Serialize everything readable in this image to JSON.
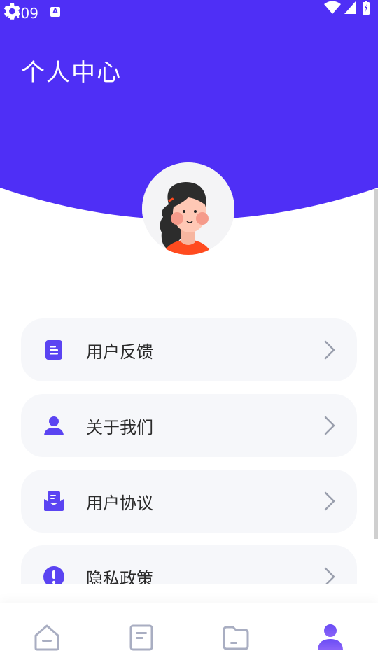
{
  "status_bar": {
    "time": "2:09",
    "notification_icon": "A"
  },
  "header": {
    "title": "个人中心",
    "bg_color": "#4f2ff6"
  },
  "icons": {
    "settings": "gear-icon",
    "avatar": "avatar-illustration"
  },
  "menu": [
    {
      "label": "用户反馈",
      "icon": "document-icon"
    },
    {
      "label": "关于我们",
      "icon": "person-icon"
    },
    {
      "label": "用户协议",
      "icon": "mail-icon"
    },
    {
      "label": "隐私政策",
      "icon": "exclamation-icon"
    }
  ],
  "tabbar": [
    {
      "icon": "home-icon",
      "active": false
    },
    {
      "icon": "document-icon",
      "active": false
    },
    {
      "icon": "folder-icon",
      "active": false
    },
    {
      "icon": "profile-icon",
      "active": true
    }
  ],
  "colors": {
    "accent": "#5b44f2",
    "inactive_icon": "#a9aec2",
    "card_bg": "#f6f7fa"
  }
}
